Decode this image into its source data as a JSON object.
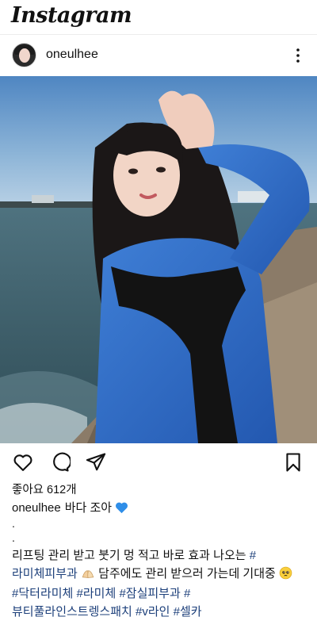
{
  "app": {
    "logo_text": "Instagram"
  },
  "post": {
    "username": "oneulhee",
    "more_icon": "more-vertical-icon",
    "likes_text": "좋아요 612개",
    "caption": {
      "username": "oneulhee",
      "first_line": "바다 조아",
      "first_line_emoji": "blue-heart-icon",
      "dots": [
        ".",
        "."
      ],
      "body_text_1": "리프팅 관리 받고 붓기 멍 적고 바로 효과 나오는",
      "tag_1": "#라미체피부과",
      "emoji_hands": "pinched-hands-icon",
      "body_text_2": "담주에도 관리 받으러 가는데 기대중",
      "emoji_face": "pleading-face-icon",
      "tags": [
        "#닥터라미체",
        "#라미체",
        "#잠실피부과",
        "#뷰티풀라인스트렝스패치",
        "#v라인",
        "#셀카"
      ]
    }
  },
  "actions": {
    "like_icon": "heart-icon",
    "comment_icon": "comment-icon",
    "share_icon": "send-icon",
    "save_icon": "bookmark-icon"
  },
  "colors": {
    "hashtag": "#1c3f7a",
    "heart_emoji": "#2f8ee8"
  }
}
